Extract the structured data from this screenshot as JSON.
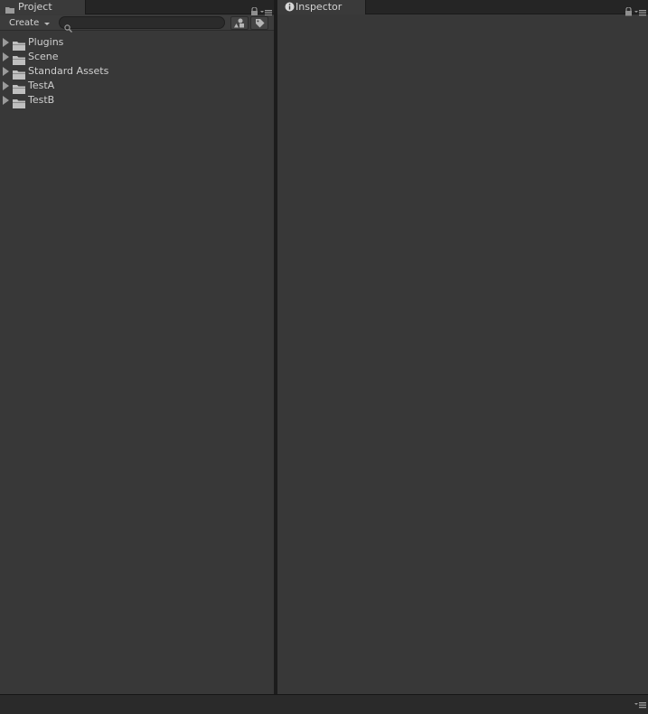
{
  "project_panel": {
    "tab_label": "Project",
    "toolbar": {
      "create_label": "Create",
      "search_placeholder": "",
      "type_filter_icon": "type-filter-icon",
      "label_filter_icon": "tag-icon"
    },
    "tree": [
      {
        "label": "Plugins",
        "icon": "folder-icon"
      },
      {
        "label": "Scene",
        "icon": "folder-icon"
      },
      {
        "label": "Standard Assets",
        "icon": "folder-icon"
      },
      {
        "label": "TestA",
        "icon": "folder-icon"
      },
      {
        "label": "TestB",
        "icon": "folder-icon"
      }
    ]
  },
  "inspector_panel": {
    "tab_label": "Inspector",
    "tab_icon": "info-icon"
  },
  "colors": {
    "panel_bg": "#383838",
    "tab_active_bg": "#3a3a3a",
    "tabbar_bg": "#252525",
    "text": "#d2d2d2"
  }
}
